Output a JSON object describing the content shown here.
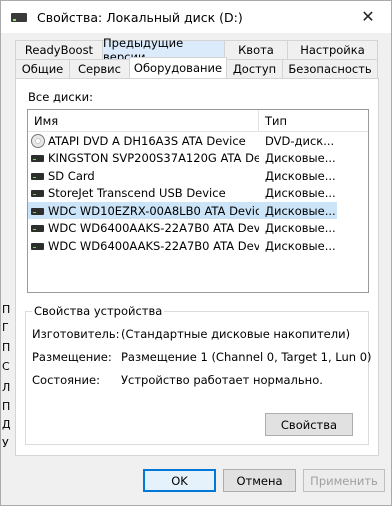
{
  "window": {
    "title": "Свойства: Локальный диск (D:)",
    "close_glyph": "✕"
  },
  "tabs_row1": [
    {
      "label": "ReadyBoost",
      "highlighted": false
    },
    {
      "label": "Предыдущие версии",
      "highlighted": true
    },
    {
      "label": "Квота",
      "highlighted": false
    },
    {
      "label": "Настройка",
      "highlighted": false
    }
  ],
  "tabs_row2": [
    {
      "label": "Общие"
    },
    {
      "label": "Сервис"
    },
    {
      "label": "Оборудование",
      "active": true
    },
    {
      "label": "Доступ"
    },
    {
      "label": "Безопасность"
    }
  ],
  "all_disks_label": "Все диски:",
  "disk_list": {
    "columns": [
      "Имя",
      "Тип"
    ],
    "rows": [
      {
        "icon": "dvd-drive-icon",
        "name": "ATAPI DVD A  DH16A3S ATA Device",
        "type": "DVD-диск...",
        "selected": false
      },
      {
        "icon": "hard-drive-icon",
        "name": "KINGSTON SVP200S37A120G ATA De...",
        "type": "Дисковые...",
        "selected": false
      },
      {
        "icon": "hard-drive-icon",
        "name": "SD Card",
        "type": "Дисковые...",
        "selected": false
      },
      {
        "icon": "hard-drive-icon",
        "name": "StoreJet Transcend USB Device",
        "type": "Дисковые...",
        "selected": false
      },
      {
        "icon": "hard-drive-icon",
        "name": "WDC WD10EZRX-00A8LB0 ATA Device",
        "type": "Дисковые...",
        "selected": true
      },
      {
        "icon": "hard-drive-icon",
        "name": "WDC WD6400AAKS-22A7B0 ATA Device",
        "type": "Дисковые...",
        "selected": false
      },
      {
        "icon": "hard-drive-icon",
        "name": "WDC WD6400AAKS-22A7B0 ATA Device",
        "type": "Дисковые...",
        "selected": false
      }
    ]
  },
  "device_properties": {
    "title": "Свойства устройства",
    "manufacturer_label": "Изготовитель:",
    "manufacturer_value": "(Стандартные дисковые накопители)",
    "location_label": "Размещение:",
    "location_value": "Размещение 1 (Channel 0, Target 1, Lun 0)",
    "status_label": "Состояние:",
    "status_value": "Устройство работает нормально.",
    "properties_button": "Свойства"
  },
  "footer": {
    "ok": "OK",
    "cancel": "Отмена",
    "apply": "Применить"
  },
  "background_fragments": [
    "П",
    "Г",
    "П",
    "С",
    "Л",
    "П",
    "Д",
    "У"
  ],
  "colors": {
    "selection": "#cce4f7",
    "accent": "#0078d7",
    "tab_highlight": "#dcebfb"
  }
}
